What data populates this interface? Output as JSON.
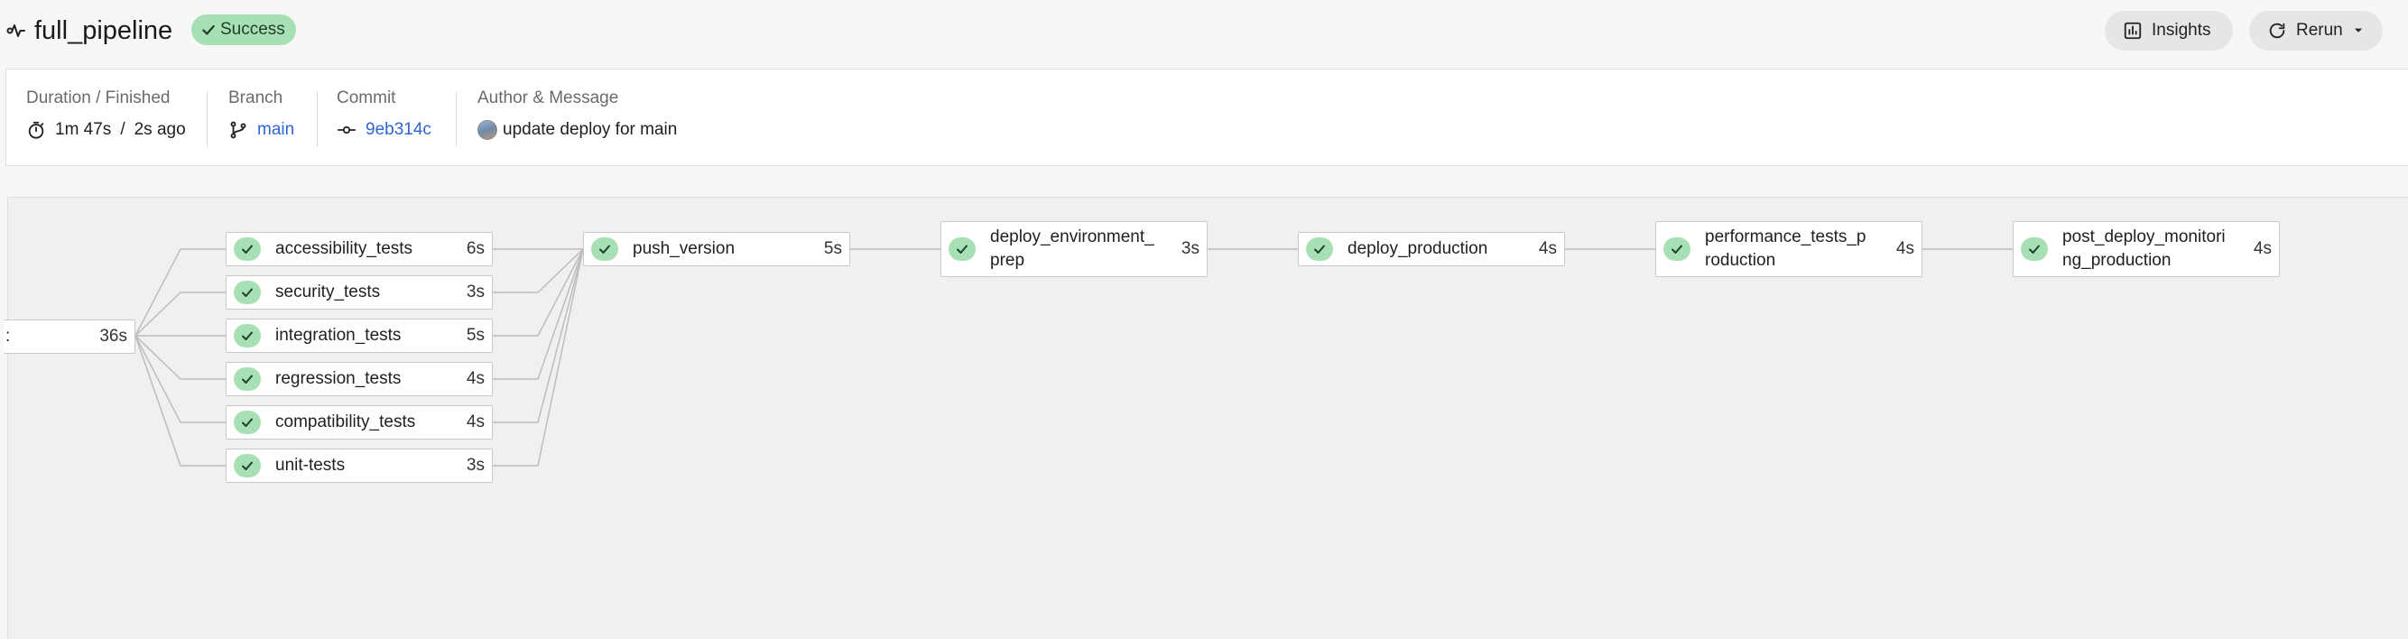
{
  "header": {
    "pipeline_icon": "pipeline-icon",
    "title": "full_pipeline",
    "status": "Success",
    "insights_label": "Insights",
    "rerun_label": "Rerun"
  },
  "info": {
    "duration_label": "Duration / Finished",
    "duration": "1m 47s",
    "separator": "/",
    "finished": "2s ago",
    "branch_label": "Branch",
    "branch": "main",
    "commit_label": "Commit",
    "commit": "9eb314c",
    "author_label": "Author & Message",
    "message": "update deploy for main"
  },
  "colors": {
    "success_bg": "#a7e0b4",
    "link": "#2e64d4"
  },
  "stages": {
    "root": {
      "name": ":",
      "duration": "36s"
    },
    "tests": [
      {
        "name": "accessibility_tests",
        "duration": "6s"
      },
      {
        "name": "security_tests",
        "duration": "3s"
      },
      {
        "name": "integration_tests",
        "duration": "5s"
      },
      {
        "name": "regression_tests",
        "duration": "4s"
      },
      {
        "name": "compatibility_tests",
        "duration": "4s"
      },
      {
        "name": "unit-tests",
        "duration": "3s"
      }
    ],
    "chain": [
      {
        "name": "push_version",
        "duration": "5s"
      },
      {
        "name": "deploy_environment_\nprep",
        "duration": "3s"
      },
      {
        "name": "deploy_production",
        "duration": "4s"
      },
      {
        "name": "performance_tests_p\nroduction",
        "duration": "4s"
      },
      {
        "name": "post_deploy_monitori\nng_production",
        "duration": "4s"
      }
    ]
  }
}
